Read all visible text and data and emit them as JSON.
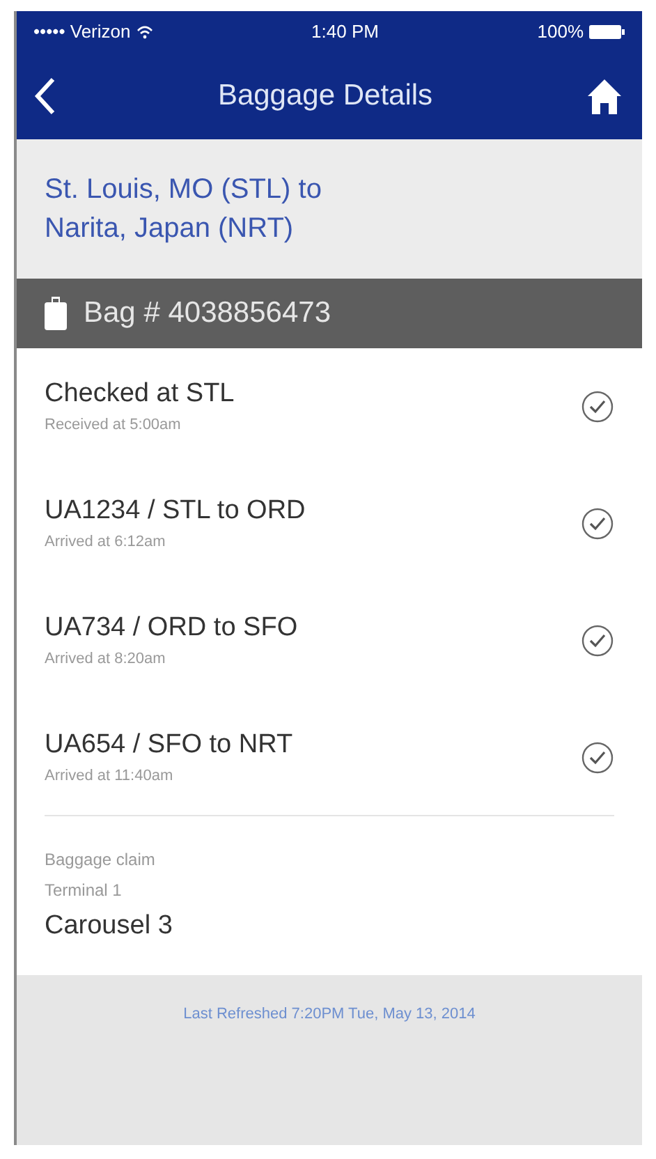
{
  "status_bar": {
    "carrier": "••••• Verizon",
    "time": "1:40 PM",
    "battery": "100%"
  },
  "nav": {
    "title": "Baggage Details"
  },
  "route": "St. Louis, MO (STL) to Narita, Japan (NRT)",
  "bag": {
    "label": "Bag # 4038856473"
  },
  "steps": [
    {
      "title": "Checked at STL",
      "detail": "Received at 5:00am",
      "checked": true
    },
    {
      "title": "UA1234 / STL to ORD",
      "detail": "Arrived at 6:12am",
      "checked": true
    },
    {
      "title": "UA734 / ORD to SFO",
      "detail": "Arrived at 8:20am",
      "checked": true
    },
    {
      "title": "UA654 / SFO to NRT",
      "detail": "Arrived at 11:40am",
      "checked": true
    }
  ],
  "claim": {
    "label": "Baggage claim",
    "terminal": "Terminal 1",
    "carousel": "Carousel 3"
  },
  "footer": "Last Refreshed 7:20PM Tue, May 13, 2014"
}
